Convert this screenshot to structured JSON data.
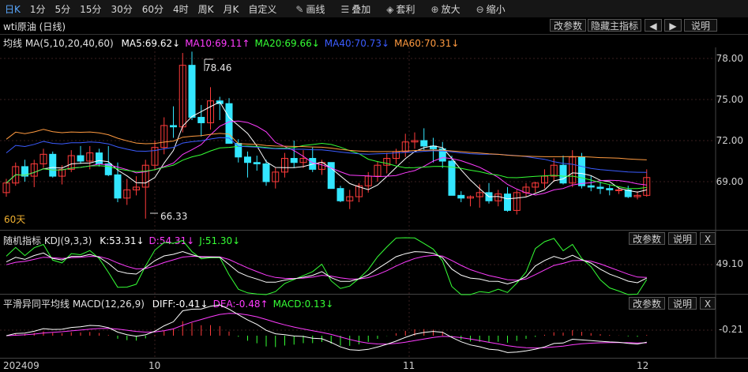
{
  "toolbar": {
    "items": [
      "日K",
      "1分",
      "5分",
      "15分",
      "30分",
      "60分",
      "4时",
      "周K",
      "月K",
      "自定义"
    ],
    "tools": [
      {
        "icon": "pencil-icon",
        "label": "画线"
      },
      {
        "icon": "layers-icon",
        "label": "叠加"
      },
      {
        "icon": "profit-icon",
        "label": "套利"
      },
      {
        "icon": "zoom-in-icon",
        "label": "放大"
      },
      {
        "icon": "zoom-out-icon",
        "label": "缩小"
      }
    ]
  },
  "subbar": {
    "title": "wti原油 (日线)",
    "buttons": [
      "改参数",
      "隐藏主指标",
      "◀",
      "▶",
      "说明"
    ]
  },
  "main_legend": {
    "name": "均线 MA(5,10,20,40,60)",
    "items": [
      {
        "label": "MA5:69.62↓",
        "color": "#ffffff"
      },
      {
        "label": "MA10:69.11↑",
        "color": "#ff3cff"
      },
      {
        "label": "MA20:69.66↓",
        "color": "#35ff35"
      },
      {
        "label": "MA40:70.73↓",
        "color": "#3b5cff"
      },
      {
        "label": "MA60:70.31↓",
        "color": "#ff9a40"
      }
    ]
  },
  "main_axis": [
    "78.00",
    "75.00",
    "72.00",
    "69.00"
  ],
  "high_label": "78.46",
  "low_label": "66.33",
  "ma_tag": "60天",
  "kdj": {
    "name": "随机指标 KDJ(9,3,3)",
    "items": [
      {
        "label": "K:53.31↓",
        "color": "#ffffff"
      },
      {
        "label": "D:54.31↓",
        "color": "#ff3cff"
      },
      {
        "label": "J:51.30↓",
        "color": "#35ff35"
      }
    ],
    "axis": "49.10",
    "buttons": [
      "改参数",
      "说明",
      "X"
    ]
  },
  "macd": {
    "name": "平滑异同平均线 MACD(12,26,9)",
    "items": [
      {
        "label": "DIFF:-0.41↓",
        "color": "#ffffff"
      },
      {
        "label": "DEA:-0.48↑",
        "color": "#ff3cff"
      },
      {
        "label": "MACD:0.13↓",
        "color": "#35ff35"
      }
    ],
    "axis": "-0.21",
    "buttons": [
      "改参数",
      "说明",
      "X"
    ]
  },
  "x_axis": [
    "202409",
    "10",
    "11",
    "12"
  ],
  "colors": {
    "up": "#ff3b3b",
    "down": "#33e6ff",
    "accent": "#5aa8ff"
  },
  "candles": [
    [
      68.2,
      69.2,
      67.9,
      68.9
    ],
    [
      68.9,
      70.4,
      68.7,
      70.1
    ],
    [
      70.1,
      70.6,
      69.0,
      69.4
    ],
    [
      69.4,
      70.6,
      68.6,
      70.3
    ],
    [
      70.3,
      71.4,
      70.0,
      71.0
    ],
    [
      71.0,
      71.2,
      69.3,
      69.4
    ],
    [
      69.4,
      70.2,
      68.8,
      69.9
    ],
    [
      69.9,
      71.3,
      69.7,
      70.9
    ],
    [
      70.9,
      71.6,
      70.3,
      70.5
    ],
    [
      70.5,
      71.6,
      69.9,
      71.1
    ],
    [
      71.1,
      71.4,
      70.1,
      70.3
    ],
    [
      70.3,
      71.6,
      69.4,
      69.5
    ],
    [
      69.5,
      70.4,
      67.5,
      67.8
    ],
    [
      67.8,
      69.2,
      67.3,
      68.4
    ],
    [
      68.4,
      69.4,
      68.0,
      68.6
    ],
    [
      68.6,
      70.6,
      66.3,
      70.2
    ],
    [
      70.2,
      72.0,
      69.9,
      71.5
    ],
    [
      71.5,
      73.7,
      71.0,
      73.1
    ],
    [
      73.1,
      74.5,
      72.2,
      73.0
    ],
    [
      73.0,
      78.4,
      72.6,
      77.5
    ],
    [
      77.5,
      78.5,
      73.5,
      73.7
    ],
    [
      73.7,
      74.6,
      72.3,
      73.3
    ],
    [
      73.3,
      75.9,
      72.8,
      74.9
    ],
    [
      74.9,
      75.2,
      73.5,
      74.7
    ],
    [
      74.7,
      75.1,
      71.9,
      71.8
    ],
    [
      71.8,
      72.1,
      70.4,
      70.8
    ],
    [
      70.8,
      71.2,
      69.3,
      70.4
    ],
    [
      70.4,
      70.9,
      69.8,
      70.3
    ],
    [
      70.3,
      70.6,
      68.7,
      69.0
    ],
    [
      69.0,
      70.0,
      68.5,
      69.7
    ],
    [
      69.7,
      71.1,
      69.3,
      70.7
    ],
    [
      70.7,
      72.0,
      70.0,
      70.4
    ],
    [
      70.4,
      71.3,
      70.0,
      70.7
    ],
    [
      70.7,
      71.5,
      69.7,
      69.9
    ],
    [
      69.9,
      70.6,
      69.5,
      70.4
    ],
    [
      70.4,
      70.4,
      68.9,
      68.5
    ],
    [
      68.5,
      68.7,
      67.5,
      67.6
    ],
    [
      67.6,
      68.4,
      67.0,
      67.9
    ],
    [
      67.9,
      68.9,
      67.5,
      68.7
    ],
    [
      68.7,
      69.7,
      68.2,
      69.4
    ],
    [
      69.4,
      70.5,
      69.0,
      70.2
    ],
    [
      70.2,
      71.1,
      69.6,
      70.7
    ],
    [
      70.7,
      71.4,
      70.3,
      71.2
    ],
    [
      71.2,
      72.5,
      70.8,
      71.9
    ],
    [
      71.9,
      72.6,
      71.4,
      72.0
    ],
    [
      72.0,
      72.9,
      71.3,
      71.6
    ],
    [
      71.6,
      72.2,
      70.4,
      71.4
    ],
    [
      71.4,
      71.9,
      70.0,
      70.5
    ],
    [
      70.5,
      70.9,
      68.2,
      68.0
    ],
    [
      68.0,
      68.3,
      67.5,
      67.8
    ],
    [
      67.8,
      68.0,
      67.2,
      67.9
    ],
    [
      67.9,
      68.8,
      67.1,
      68.2
    ],
    [
      68.2,
      68.9,
      67.4,
      67.6
    ],
    [
      67.6,
      68.4,
      67.2,
      68.1
    ],
    [
      68.1,
      68.6,
      66.8,
      66.9
    ],
    [
      66.9,
      68.4,
      66.6,
      68.2
    ],
    [
      68.2,
      68.9,
      67.9,
      68.6
    ],
    [
      68.6,
      69.0,
      68.2,
      68.9
    ],
    [
      68.9,
      69.9,
      68.5,
      69.4
    ],
    [
      69.4,
      70.7,
      69.0,
      70.2
    ],
    [
      70.2,
      70.9,
      68.8,
      68.9
    ],
    [
      68.9,
      71.3,
      68.6,
      70.8
    ],
    [
      70.8,
      71.1,
      68.5,
      68.7
    ],
    [
      68.7,
      69.4,
      68.3,
      68.6
    ],
    [
      68.6,
      69.0,
      68.1,
      68.5
    ],
    [
      68.5,
      68.8,
      68.0,
      68.4
    ],
    [
      68.4,
      68.6,
      68.1,
      68.4
    ],
    [
      68.4,
      68.7,
      67.8,
      67.9
    ],
    [
      67.9,
      68.3,
      67.7,
      68.0
    ],
    [
      68.0,
      69.9,
      67.9,
      69.3
    ]
  ]
}
